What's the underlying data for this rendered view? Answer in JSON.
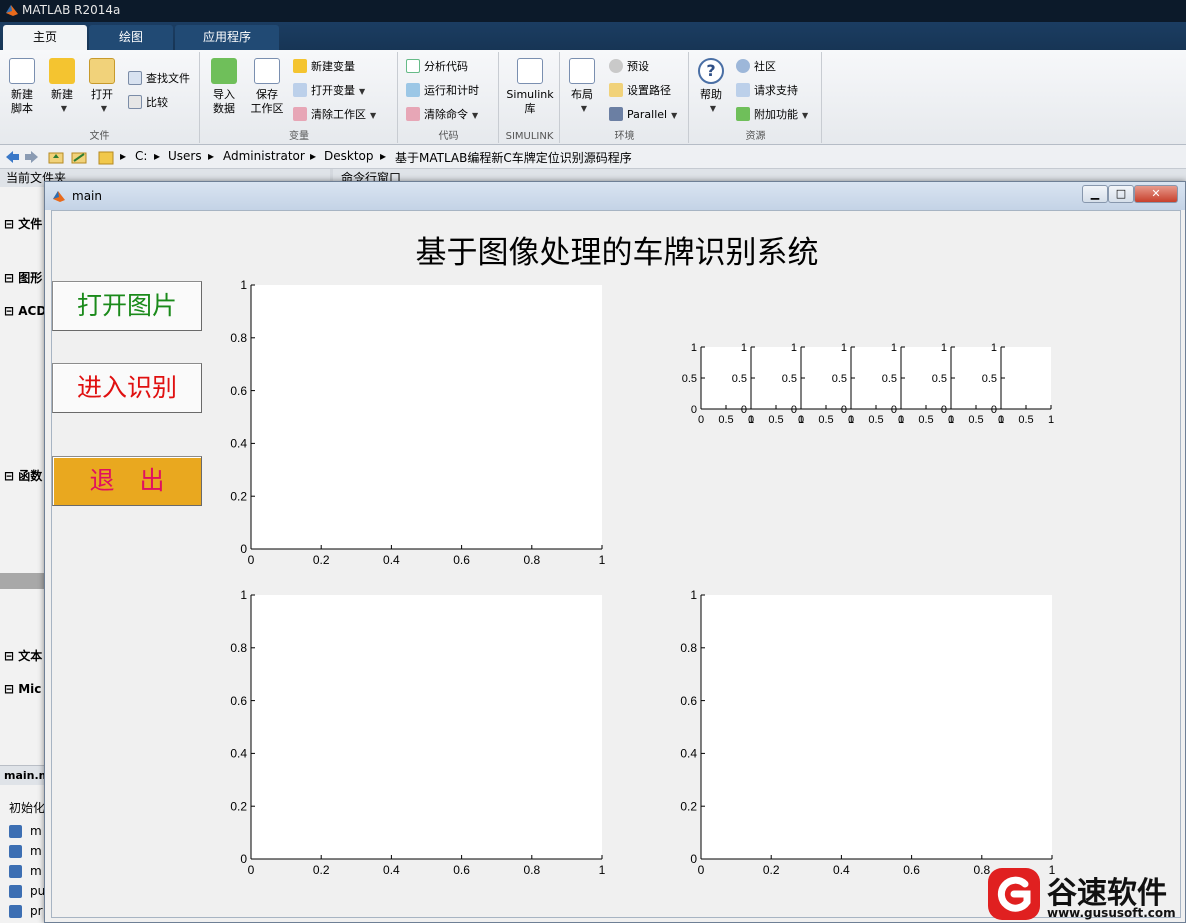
{
  "window": {
    "title": "MATLAB R2014a"
  },
  "tabs": [
    {
      "label": "主页",
      "active": true
    },
    {
      "label": "绘图",
      "active": false
    },
    {
      "label": "应用程序",
      "active": false
    }
  ],
  "ribbon": {
    "file": {
      "group_label": "文件",
      "new_script": "新建\n脚本",
      "new": "新建",
      "open": "打开",
      "find_files": "查找文件",
      "compare": "比较"
    },
    "variable": {
      "group_label": "变量",
      "import_data": "导入\n数据",
      "save_workspace": "保存\n工作区",
      "new_variable": "新建变量",
      "open_variable": "打开变量",
      "clear_workspace": "清除工作区"
    },
    "code": {
      "group_label": "代码",
      "analyze_code": "分析代码",
      "run_and_time": "运行和计时",
      "clear_commands": "清除命令"
    },
    "simulink": {
      "group_label": "SIMULINK",
      "library": "Simulink\n库"
    },
    "environment": {
      "group_label": "环境",
      "layout": "布局",
      "preferences": "预设",
      "set_path": "设置路径",
      "parallel": "Parallel"
    },
    "resources": {
      "group_label": "资源",
      "help": "帮助",
      "community": "社区",
      "request_support": "请求支持",
      "add_ons": "附加功能"
    }
  },
  "address": {
    "crumbs": [
      "C:",
      "Users",
      "Administrator",
      "Desktop",
      "基于MATLAB编程新C车牌定位识别源码程序"
    ]
  },
  "left_panel": {
    "header": "当前文件夹",
    "sections": [
      "文件",
      "图形",
      "ACD",
      "函数",
      "文本",
      "Mic"
    ],
    "bottom_file": "main.m",
    "bottom_text": "初始化",
    "func_prefixes": [
      "m",
      "m",
      "m",
      "pu",
      "pr"
    ]
  },
  "command_window": {
    "header": "命令行窗口"
  },
  "figure": {
    "title": "main",
    "app_title": "基于图像处理的车牌识别系统",
    "buttons": {
      "open_image": "打开图片",
      "recognize": "进入识别",
      "exit": "退　出"
    },
    "axes_ticks": {
      "large": [
        "0",
        "0.2",
        "0.4",
        "0.6",
        "0.8",
        "1"
      ],
      "small_x": [
        "0",
        "0.5",
        "1"
      ],
      "small_y": [
        "0",
        "0.5",
        "1"
      ]
    },
    "small_axes_count": 7
  },
  "watermark": {
    "brand": "谷速软件",
    "url": "www.gususoft.com"
  },
  "colors": {
    "titlebar": "#0c1a2a",
    "tabbar": "#1b3d62",
    "open_btn_text": "#1a8a1a",
    "rec_btn_text": "#e01010",
    "exit_btn_bg": "#e9a81f",
    "exit_btn_text": "#e01060",
    "watermark_red": "#e02020"
  }
}
